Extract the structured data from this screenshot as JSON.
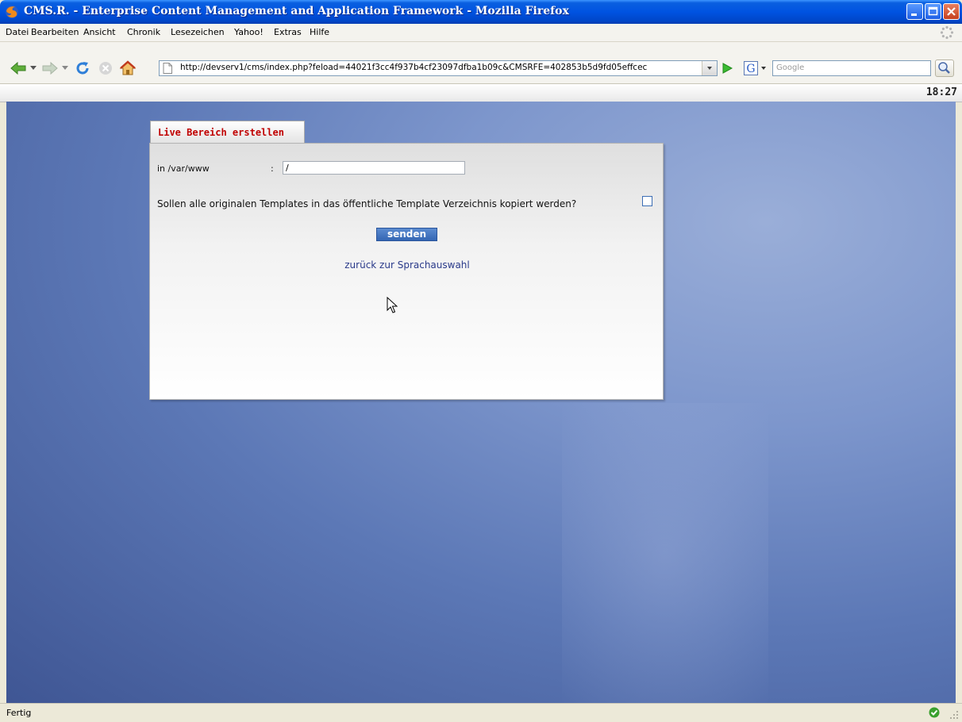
{
  "window": {
    "title": "CMS.R. - Enterprise Content Management and Application Framework - Mozilla Firefox"
  },
  "menu": {
    "items": [
      "Datei",
      "Bearbeiten",
      "Ansicht",
      "Chronik",
      "Lesezeichen",
      "Yahoo!",
      "Extras",
      "Hilfe"
    ]
  },
  "navigation": {
    "url": "http://devserv1/cms/index.php?feload=44021f3cc4f937b4cf23097dfba1b09c&CMSRFE=402853b5d9fd05effcec",
    "search_placeholder": "Google"
  },
  "toolbar": {
    "clock": "18:27"
  },
  "form": {
    "tab_title": "Live Bereich erstellen",
    "path_label": "in /var/www",
    "path_separator": ":",
    "path_value": "/",
    "copy_templates_question": "Sollen alle originalen Templates in das öffentliche Template Verzeichnis kopiert werden?",
    "copy_templates_checked": false,
    "submit_label": "senden",
    "back_link": "zurück zur Sprachauswahl"
  },
  "status": {
    "text": "Fertig"
  },
  "colors": {
    "titlebar": "#0053e1",
    "tab_title": "#c00000",
    "button": "#3466b4",
    "link": "#2a3a8a"
  }
}
